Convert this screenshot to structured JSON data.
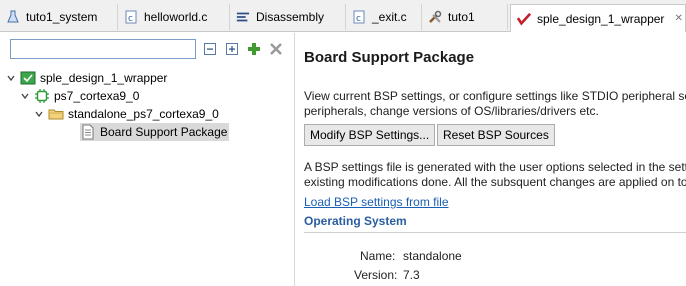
{
  "tabs": [
    {
      "label": "tuto1_system",
      "icon": "flask-icon"
    },
    {
      "label": "helloworld.c",
      "icon": "c-file-icon"
    },
    {
      "label": "Disassembly",
      "icon": "disassembly-icon"
    },
    {
      "label": "_exit.c",
      "icon": "c-file-icon"
    },
    {
      "label": "tuto1",
      "icon": "tools-icon"
    },
    {
      "label": "sple_design_1_wrapper",
      "icon": "vitis-icon",
      "active": true
    }
  ],
  "sidebar": {
    "search_value": "",
    "tree": [
      {
        "label": "sple_design_1_wrapper",
        "icon": "platform-icon"
      },
      {
        "label": "ps7_cortexa9_0",
        "icon": "processor-icon"
      },
      {
        "label": "standalone_ps7_cortexa9_0",
        "icon": "folder-icon"
      },
      {
        "label": "Board Support Package",
        "icon": "document-icon"
      }
    ]
  },
  "main": {
    "title": "Board Support Package",
    "desc_line1": "View current BSP settings, or configure settings like STDIO peripheral selection, compiler flags, SW intrusive profiling, add/remove libraries, assign drivers to",
    "desc_line2": "peripherals, change versions of OS/libraries/drivers etc.",
    "modify_button": "Modify BSP Settings...",
    "reset_button": "Reset BSP Sources",
    "info_line1": "A BSP settings file is generated with the user options selected in the settings dialog. Use this option to regenerate the BSP sources. This does not delete",
    "info_line2": "existing modifications done. All the subsquent changes are applied on top of the regenerated sources.",
    "load_link": "Load BSP settings from file",
    "section_title": "Operating System",
    "name_label": "Name:",
    "name_value": "standalone",
    "version_label": "Version:",
    "version_value": "7.3"
  }
}
